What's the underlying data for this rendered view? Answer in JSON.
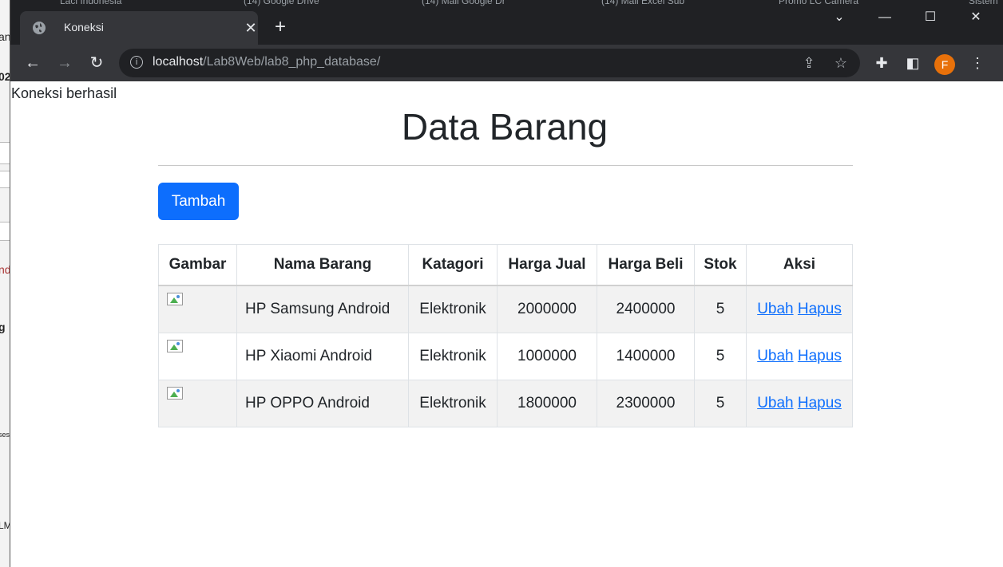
{
  "browser": {
    "background_tabs": [
      "Laci Indonesia",
      "(14) Google Drive",
      "(14) Mail Google Dr",
      "(14) Mail Excel Sub",
      "Promo LC Camera",
      "Sistem"
    ],
    "tab": {
      "title": "Koneksi",
      "icon": "globe-icon"
    },
    "new_tab_label": "+",
    "url": {
      "host": "localhost",
      "path": "/Lab8Web/lab8_php_database/"
    },
    "profile_initial": "F"
  },
  "page": {
    "connection_status": "Koneksi berhasil",
    "title": "Data Barang",
    "add_button": "Tambah",
    "table": {
      "headers": [
        "Gambar",
        "Nama Barang",
        "Katagori",
        "Harga Jual",
        "Harga Beli",
        "Stok",
        "Aksi"
      ],
      "rows": [
        {
          "name": "HP Samsung Android",
          "category": "Elektronik",
          "sell": "2000000",
          "buy": "2400000",
          "stock": "5",
          "edit": "Ubah",
          "delete": "Hapus"
        },
        {
          "name": "HP Xiaomi Android",
          "category": "Elektronik",
          "sell": "1000000",
          "buy": "1400000",
          "stock": "5",
          "edit": "Ubah",
          "delete": "Hapus"
        },
        {
          "name": "HP OPPO Android",
          "category": "Elektronik",
          "sell": "1800000",
          "buy": "2300000",
          "stock": "5",
          "edit": "Ubah",
          "delete": "Hapus"
        }
      ]
    }
  },
  "background_window": {
    "fragments": [
      "an",
      "02",
      "nd",
      "g",
      "ses",
      "LM"
    ]
  },
  "colors": {
    "primary": "#0d6efd",
    "chrome_dark": "#202124",
    "chrome_toolbar": "#35363a",
    "avatar": "#e8710a"
  }
}
